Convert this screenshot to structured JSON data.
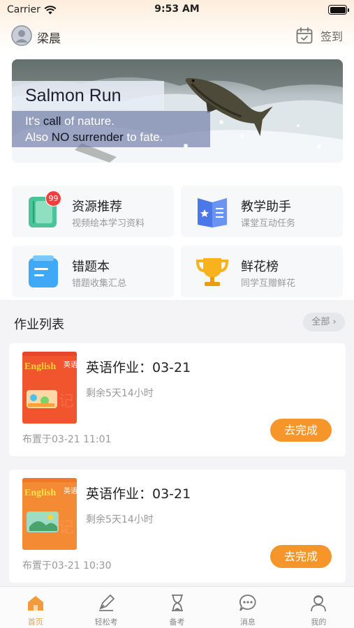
{
  "status_bar": {
    "carrier": "Carrier",
    "time": "9:53 AM"
  },
  "header": {
    "user_name": "梁晨",
    "checkin_label": "签到"
  },
  "banner": {
    "title": "Salmon Run",
    "line1_a": "It's ",
    "line1_b": "call",
    "line1_c": " of nature.",
    "line2_a": "Also ",
    "line2_b": "NO surrender",
    "line2_c": " to fate."
  },
  "quick_menu": [
    {
      "title": "资源推荐",
      "subtitle": "视频绘本学习资料",
      "badge": "99",
      "icon": "resource-book-icon"
    },
    {
      "title": "教学助手",
      "subtitle": "课堂互动任务",
      "icon": "teaching-book-icon"
    },
    {
      "title": "错题本",
      "subtitle": "错题收集汇总",
      "icon": "mistake-notebook-icon"
    },
    {
      "title": "鲜花榜",
      "subtitle": "同学互赠鲜花",
      "icon": "trophy-icon"
    }
  ],
  "homework": {
    "section_title": "作业列表",
    "all_label": "全部",
    "items": [
      {
        "title": "英语作业：03-21",
        "remaining": "剩余5天14小时",
        "assigned": "布置于03-21 11:01",
        "action": "去完成",
        "cover_text": "English",
        "cover_cn": "英语"
      },
      {
        "title": "英语作业：03-21",
        "remaining": "剩余5天14小时",
        "assigned": "布置于03-21 10:30",
        "action": "去完成",
        "cover_text": "English",
        "cover_cn": "英语"
      }
    ]
  },
  "tabbar": [
    {
      "label": "首页",
      "icon": "home-icon",
      "active": true
    },
    {
      "label": "轻松考",
      "icon": "pen-icon"
    },
    {
      "label": "备考",
      "icon": "hourglass-icon"
    },
    {
      "label": "消息",
      "icon": "message-icon"
    },
    {
      "label": "我的",
      "icon": "profile-icon"
    }
  ],
  "colors": {
    "accent": "#f6962a",
    "badge": "#f53d3d",
    "tab_active": "#f39a3c"
  }
}
